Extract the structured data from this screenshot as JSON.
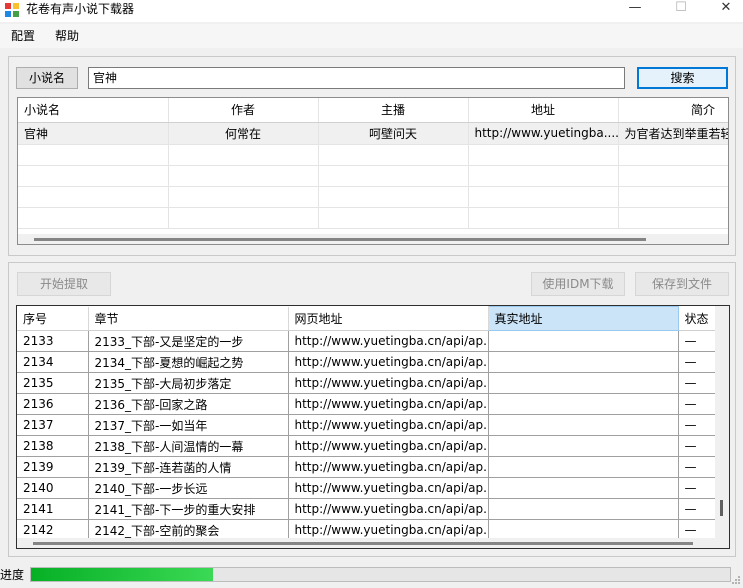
{
  "window": {
    "title": "花卷有声小说下载器",
    "minimize_glyph": "—",
    "maximize_glyph": "☐",
    "close_glyph": "✕"
  },
  "menu": [
    "配置",
    "帮助"
  ],
  "search": {
    "label": "小说名",
    "value": "官神",
    "button": "搜索"
  },
  "results": {
    "columns": [
      "小说名",
      "作者",
      "主播",
      "地址",
      "简介"
    ],
    "rows": [
      [
        "官神",
        "何常在",
        "呵壁问天",
        "http://www.yuetingba....",
        "为官者达到举重若轻"
      ]
    ]
  },
  "actions": {
    "start": "开始提取",
    "idm": "使用IDM下载",
    "save": "保存到文件"
  },
  "chapters": {
    "columns": [
      "序号",
      "章节",
      "网页地址",
      "真实地址",
      "状态"
    ],
    "rows": [
      [
        "2133",
        "2133_下部-又是坚定的一步",
        "http://www.yuetingba.cn/api/ap...",
        "",
        "—"
      ],
      [
        "2134",
        "2134_下部-夏想的崛起之势",
        "http://www.yuetingba.cn/api/ap...",
        "",
        "—"
      ],
      [
        "2135",
        "2135_下部-大局初步落定",
        "http://www.yuetingba.cn/api/ap...",
        "",
        "—"
      ],
      [
        "2136",
        "2136_下部-回家之路",
        "http://www.yuetingba.cn/api/ap...",
        "",
        "—"
      ],
      [
        "2137",
        "2137_下部-一如当年",
        "http://www.yuetingba.cn/api/ap...",
        "",
        "—"
      ],
      [
        "2138",
        "2138_下部-人间温情的一幕",
        "http://www.yuetingba.cn/api/ap...",
        "",
        "—"
      ],
      [
        "2139",
        "2139_下部-连若菡的人情",
        "http://www.yuetingba.cn/api/ap...",
        "",
        "—"
      ],
      [
        "2140",
        "2140_下部-一步长远",
        "http://www.yuetingba.cn/api/ap...",
        "",
        "—"
      ],
      [
        "2141",
        "2141_下部-下一步的重大安排",
        "http://www.yuetingba.cn/api/ap...",
        "",
        "—"
      ],
      [
        "2142",
        "2142_下部-空前的聚会",
        "http://www.yuetingba.cn/api/ap...",
        "",
        "—"
      ]
    ]
  },
  "status": {
    "label": "进度",
    "progress_fraction": 0.26
  }
}
